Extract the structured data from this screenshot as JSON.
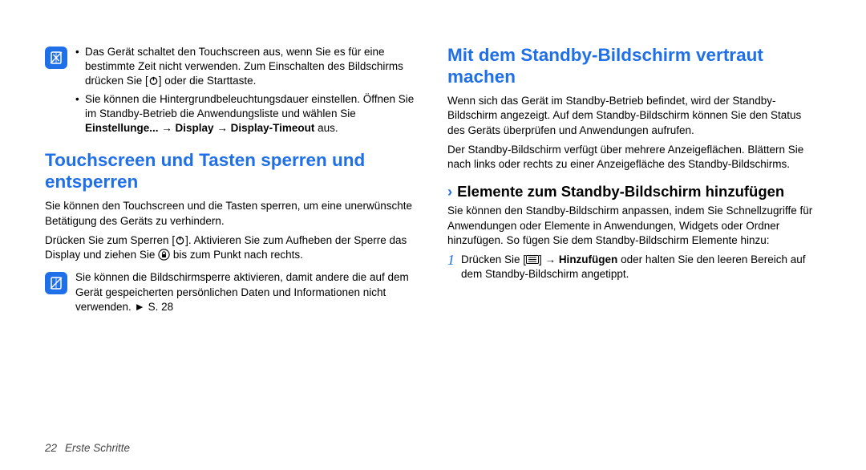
{
  "col1": {
    "note1": {
      "bullets": [
        {
          "pre": "Das Gerät schaltet den Touchscreen aus, wenn Sie es für eine bestimmte Zeit nicht verwenden. Zum Einschalten des Bildschirms drücken Sie [",
          "icon": "power",
          "post": "] oder die Starttaste."
        },
        {
          "full": "Sie können die Hintergrundbeleuchtungsdauer einstellen. Öffnen Sie im Standby-Betrieb die Anwendungsliste und wählen Sie ",
          "bold1": "Einstellunge...",
          "arrow1": " → ",
          "bold2": "Display",
          "arrow2": " → ",
          "bold3": "Display-Timeout",
          "aus": " aus."
        }
      ]
    },
    "h2": "Touchscreen und Tasten sperren und entsperren",
    "p1": "Sie können den Touchscreen und die Tasten sperren, um eine unerwünschte Betätigung des Geräts zu verhindern.",
    "p2_pre": "Drücken Sie zum Sperren [",
    "p2_icon1": "power",
    "p2_mid": "]. Aktivieren Sie zum Aufheben der Sperre das Display und ziehen Sie ",
    "p2_icon2": "lock",
    "p2_post": " bis zum Punkt nach rechts.",
    "note2_text": "Sie können die Bildschirmsperre aktivieren, damit andere die auf dem Gerät gespeicherten persönlichen Daten und Informationen nicht verwenden. ► S. 28"
  },
  "col2": {
    "h2": "Mit dem Standby-Bildschirm vertraut machen",
    "p1": "Wenn sich das Gerät im Standby-Betrieb befindet, wird der Standby-Bildschirm angezeigt. Auf dem Standby-Bildschirm können Sie den Status des Geräts überprüfen und Anwendungen aufrufen.",
    "p2": "Der Standby-Bildschirm verfügt über mehrere Anzeigeflächen. Blättern Sie nach links oder rechts zu einer Anzeigefläche des Standby-Bildschirms.",
    "h3": "Elemente zum Standby-Bildschirm hinzufügen",
    "p3": "Sie können den Standby-Bildschirm anpassen, indem Sie Schnellzugriffe für Anwendungen oder Elemente in Anwendungen, Widgets oder Ordner hinzufügen. So fügen Sie dem Standby-Bildschirm Elemente hinzu:",
    "step1": {
      "num": "1",
      "pre": "Drücken Sie [",
      "icon": "menu",
      "mid": "] → ",
      "bold": "Hinzufügen",
      "post": " oder halten Sie den leeren Bereich auf dem Standby-Bildschirm angetippt."
    }
  },
  "footer": {
    "page": "22",
    "section": "Erste Schritte"
  }
}
